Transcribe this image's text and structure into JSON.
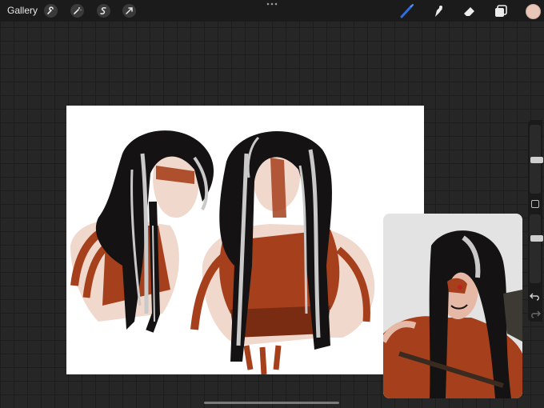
{
  "topbar": {
    "gallery_label": "Gallery",
    "left_tools": [
      {
        "icon": "wrench-icon"
      },
      {
        "icon": "magic-wand-icon"
      },
      {
        "icon": "selection-icon"
      },
      {
        "icon": "transform-arrow-icon"
      }
    ],
    "more_icon": "ellipsis-icon",
    "right_tools": [
      {
        "icon": "brush-icon",
        "active_color": "#2d6fe0"
      },
      {
        "icon": "smudge-icon"
      },
      {
        "icon": "eraser-icon"
      },
      {
        "icon": "layers-icon"
      }
    ],
    "current_color": "#e9c6b8"
  },
  "sidebar": {
    "brush_size_level": 0.2,
    "opacity_level": 0.6,
    "modify_icon": "square-icon",
    "undo_icon": "undo-icon",
    "redo_icon": "redo-icon"
  },
  "colors": {
    "skin": "#f0d8cc",
    "rust": "#a6401c",
    "rust_dark": "#7a2c12",
    "hair": "#141212",
    "hair_silver": "#c9c9c9",
    "blush": "#e6b8a6"
  }
}
